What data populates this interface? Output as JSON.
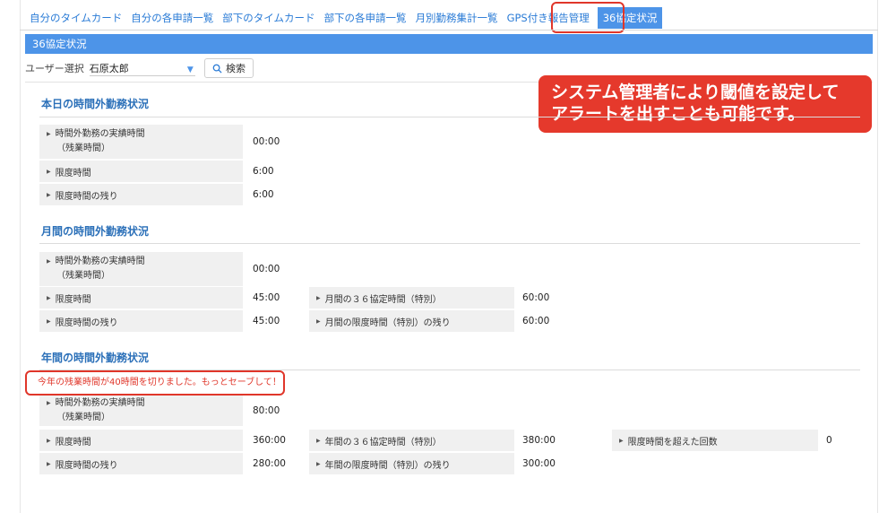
{
  "nav": {
    "tabs": [
      "自分のタイムカード",
      "自分の各申請一覧",
      "部下のタイムカード",
      "部下の各申請一覧",
      "月別勤務集計一覧",
      "GPS付き報告管理",
      "36協定状況"
    ]
  },
  "section_title": "36協定状況",
  "user_select": {
    "label": "ユーザー選択",
    "value": "石原太郎"
  },
  "search_button": "検索",
  "callout": {
    "line1": "システム管理者により閾値を設定して",
    "line2": "アラートを出すことも可能です。"
  },
  "daily": {
    "title": "本日の時間外勤務状況",
    "actual_label_1": "時間外勤務の実績時間",
    "actual_label_2": "（残業時間）",
    "actual_value": "00:00",
    "limit_label": "限度時間",
    "limit_value": "6:00",
    "remaining_label": "限度時間の残り",
    "remaining_value": "6:00"
  },
  "monthly": {
    "title": "月間の時間外勤務状況",
    "actual_label_1": "時間外勤務の実績時間",
    "actual_label_2": "（残業時間）",
    "actual_value": "00:00",
    "limit_label": "限度時間",
    "limit_value": "45:00",
    "remaining_label": "限度時間の残り",
    "remaining_value": "45:00",
    "special_label": "月間の３６協定時間（特別）",
    "special_value": "60:00",
    "special_remaining_label": "月間の限度時間（特別）の残り",
    "special_remaining_value": "60:00"
  },
  "yearly": {
    "title": "年間の時間外勤務状況",
    "alert": "今年の残業時間が40時間を切りました。もっとセーブして！",
    "actual_label_1": "時間外勤務の実績時間",
    "actual_label_2": "（残業時間）",
    "actual_value": "80:00",
    "limit_label": "限度時間",
    "limit_value": "360:00",
    "remaining_label": "限度時間の残り",
    "remaining_value": "280:00",
    "special_label": "年間の３６協定時間（特別）",
    "special_value": "380:00",
    "special_remaining_label": "年間の限度時間（特別）の残り",
    "special_remaining_value": "300:00",
    "exceeded_label": "限度時間を超えた回数",
    "exceeded_value": "0"
  }
}
